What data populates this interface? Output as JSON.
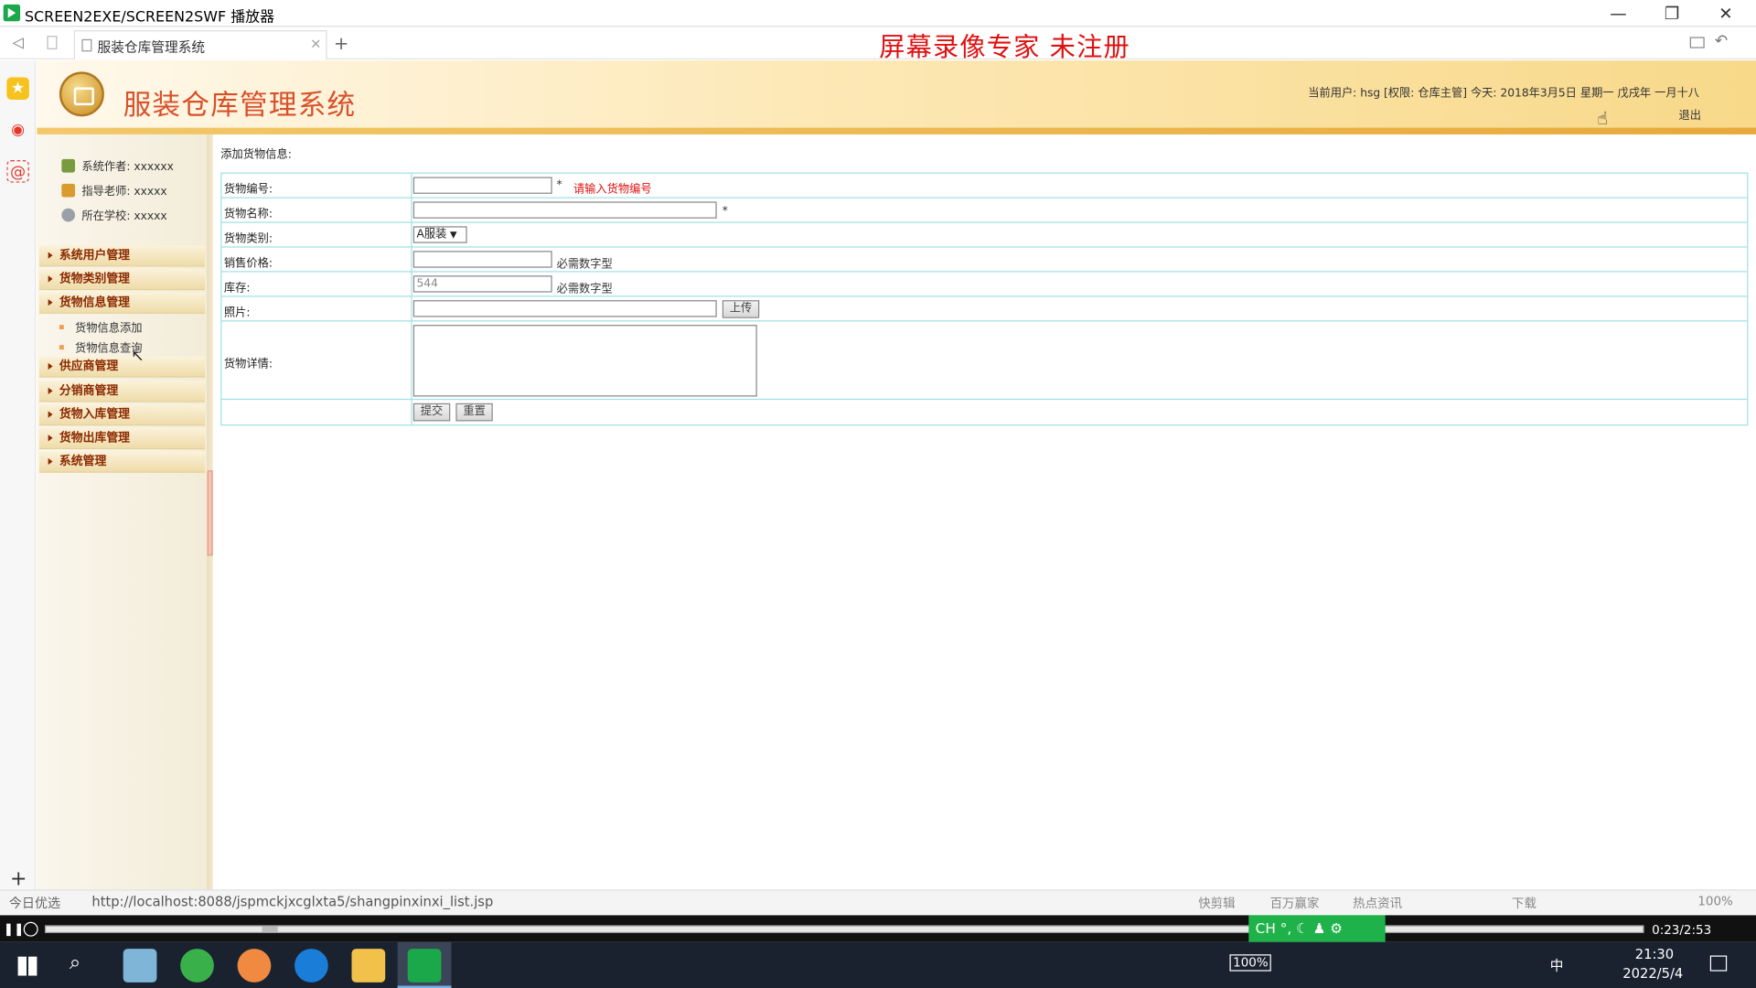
{
  "window": {
    "title": "SCREEN2EXE/SCREEN2SWF 播放器",
    "minimize": "—",
    "restore": "❐",
    "close": "✕"
  },
  "browser": {
    "back": "◁",
    "tab_title": "服装仓库管理系统",
    "tab_close": "×",
    "new_tab": "+",
    "watermark": "屏幕录像专家 未注册",
    "add": "+"
  },
  "header": {
    "system_title": "服装仓库管理系统",
    "user_info": "当前用户: hsg [权限: 仓库主管] 今天: 2018年3月5日 星期一 戊戌年 一月十八",
    "logout": "退出"
  },
  "sidebar": {
    "info": [
      {
        "label": "系统作者: xxxxxx",
        "icon": "user-icon",
        "color": "#7a9a40"
      },
      {
        "label": "指导老师: xxxxx",
        "icon": "teacher-icon",
        "color": "#d99a30"
      },
      {
        "label": "所在学校: xxxxx",
        "icon": "school-icon",
        "color": "#9aa0a8"
      }
    ],
    "menus": [
      {
        "label": "系统用户管理"
      },
      {
        "label": "货物类别管理"
      },
      {
        "label": "货物信息管理",
        "children": [
          "货物信息添加",
          "货物信息查询"
        ]
      },
      {
        "label": "供应商管理"
      },
      {
        "label": "分销商管理"
      },
      {
        "label": "货物入库管理"
      },
      {
        "label": "货物出库管理"
      },
      {
        "label": "系统管理"
      }
    ]
  },
  "form": {
    "caption": "添加货物信息:",
    "fields": {
      "code": {
        "label": "货物编号:",
        "value": "",
        "required": "*",
        "error": "请输入货物编号"
      },
      "name": {
        "label": "货物名称:",
        "value": "",
        "required": "*"
      },
      "category": {
        "label": "货物类别:",
        "selected": "A服装"
      },
      "price": {
        "label": "销售价格:",
        "value": "",
        "hint": "必需数字型"
      },
      "stock": {
        "label": "库存:",
        "value": "544",
        "hint": "必需数字型"
      },
      "photo": {
        "label": "照片:",
        "value": "",
        "upload": "上传"
      },
      "detail": {
        "label": "货物详情:",
        "value": ""
      }
    },
    "submit": "提交",
    "reset": "重置"
  },
  "statusbar": {
    "today": "今日优选",
    "url": "http://localhost:8088/jspmckjxcglxta5/shangpinxinxi_list.jsp",
    "items": [
      "快剪辑",
      "百万赢家",
      "热点资讯",
      "下载",
      "100%"
    ]
  },
  "player": {
    "time": "0:23/2:53",
    "ime": "CH °, ☾ ♟ ⚙"
  },
  "taskbar": {
    "battery": "100%",
    "ime_lang": "中",
    "time": "21:30",
    "date": "2022/5/4"
  },
  "colors": {
    "accent_red": "#e01010",
    "title_orange": "#d8502a",
    "menu_text": "#8b2a00",
    "table_border": "#9fe0e8",
    "ime_green": "#1fb24a"
  }
}
